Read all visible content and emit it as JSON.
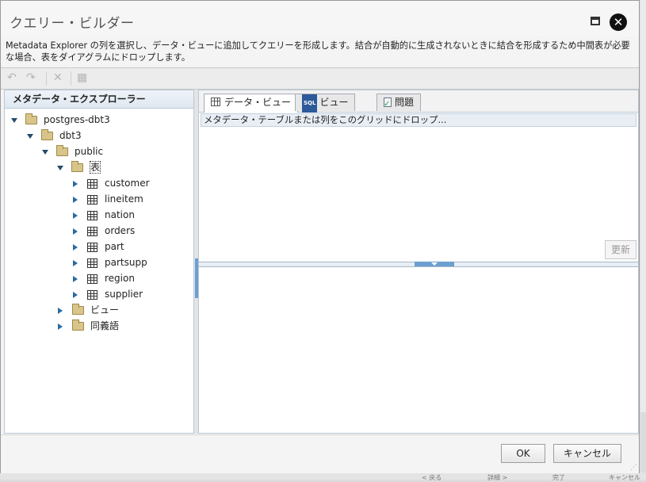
{
  "dialog": {
    "title": "クエリー・ビルダー",
    "description": "Metadata Explorer の列を選択し、データ・ビューに追加してクエリーを形成します。結合が自動的に生成されないときに結合を形成するため中間表が必要な場合、表をダイアグラムにドロップします。"
  },
  "toolbar": {
    "undo_icon": "undo-icon",
    "redo_icon": "redo-icon",
    "delete_icon": "delete-icon",
    "add_icon": "add-table-icon"
  },
  "explorer": {
    "header": "メタデータ・エクスプローラー",
    "root": "postgres-dbt3",
    "database": "dbt3",
    "schema": "public",
    "tables_folder": "表",
    "tables": [
      "customer",
      "lineitem",
      "nation",
      "orders",
      "part",
      "partsupp",
      "region",
      "supplier"
    ],
    "views_folder": "ビュー",
    "synonyms_folder": "同義語"
  },
  "tabs": {
    "data_view": "データ・ビュー",
    "sql_badge": "SQL",
    "sql_view": "ビュー",
    "problems": "問題"
  },
  "data_view": {
    "drop_hint": "メタデータ・テーブルまたは列をこのグリッドにドロップ...",
    "refresh": "更新"
  },
  "footer": {
    "ok": "OK",
    "cancel": "キャンセル"
  },
  "background": {
    "bits": [
      "< 戻る",
      "詳細 >",
      "完了",
      "キャンセル"
    ]
  },
  "colors": {
    "accent": "#6c9fd0",
    "folder": "#d9c58a",
    "header_bg": "#dfe8f1"
  }
}
